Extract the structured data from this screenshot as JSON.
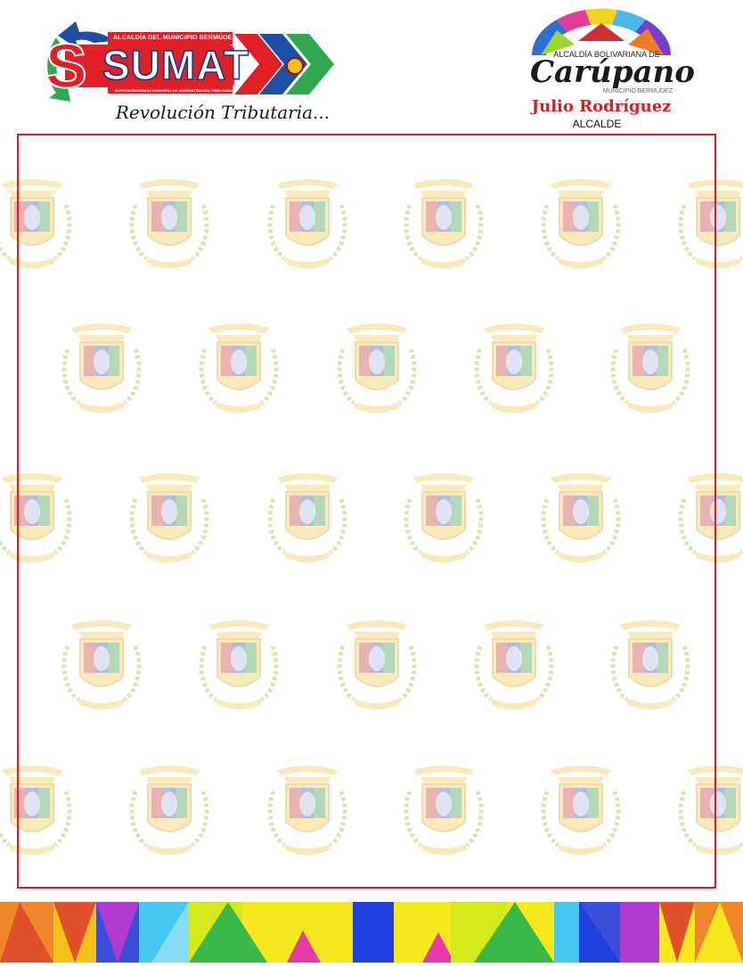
{
  "header": {
    "sumat": {
      "top_text": "ALCALDÍA DEL MUNICIPIO BERMÚDEZ",
      "name": "SUMAT",
      "bottom_text": "SUPERINTENDENCIA MUNICIPAL DE ADMINISTRACIÓN TRIBUTARIA",
      "tagline": "Revolución Tributaria..."
    },
    "carupano": {
      "top_text": "ALCALDÍA BOLIVARIANA DE",
      "name": "Carúpano",
      "municipality": "MUNICIPIO BERMÚDEZ",
      "mayor": "Julio Rodríguez",
      "role": "ALCALDE"
    }
  },
  "colors": {
    "frame": "#e21b1b",
    "sumat_red": "#e01f26",
    "sumat_blue": "#1b4fa8",
    "sumat_green": "#2fa84f",
    "mayor_red": "#d81f1f"
  },
  "watermark": {
    "icon": "municipal-coat-of-arms-icon"
  }
}
